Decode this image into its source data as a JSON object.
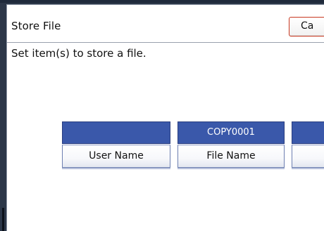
{
  "dialog": {
    "title": "Store File",
    "cancel_label": "Ca",
    "instruction": "Set item(s) to store a file."
  },
  "fields": [
    {
      "label": "User Name",
      "value": ""
    },
    {
      "label": "File Name",
      "value": "COPY0001"
    },
    {
      "label": "",
      "value": ""
    }
  ],
  "colors": {
    "value_bg": "#3a58aa",
    "cancel_border": "#c8371f",
    "frame": "#2c3748"
  }
}
